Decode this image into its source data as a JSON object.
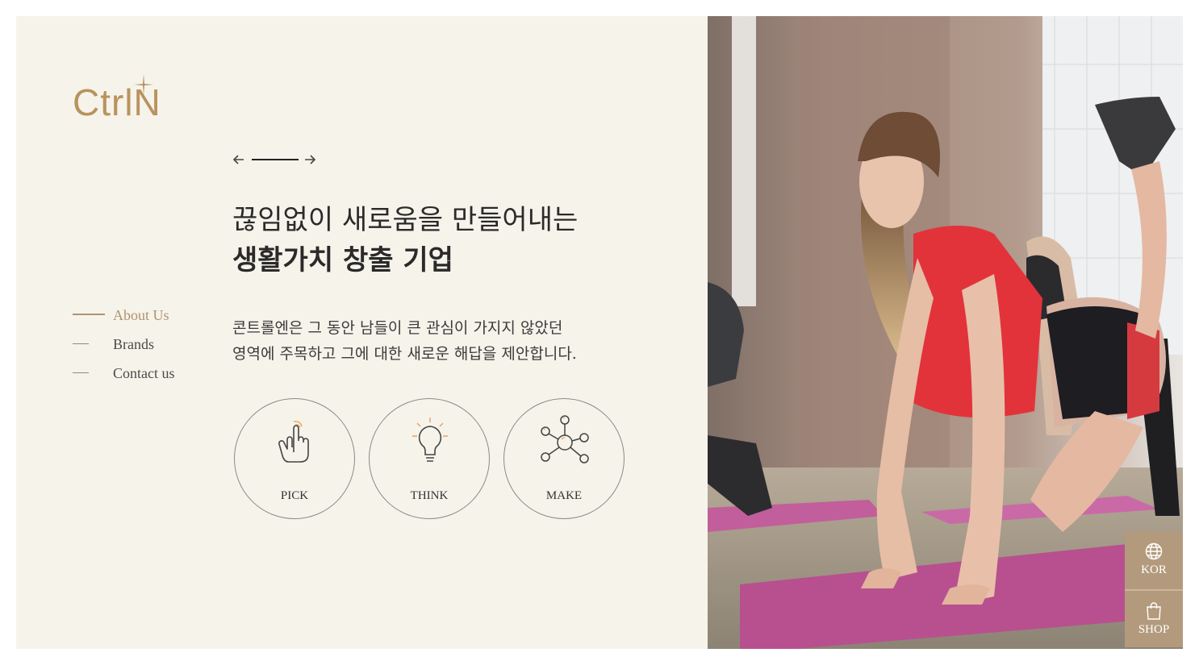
{
  "brand": {
    "logo_text": "CtrlN",
    "accent_color": "#b8935e"
  },
  "slider": {
    "prev_icon": "arrow-left-icon",
    "next_icon": "arrow-right-icon"
  },
  "hero": {
    "headline_line1": "끊임없이 새로움을 만들어내는",
    "headline_line2": "생활가치 창출 기업",
    "description_line1": "콘트롤엔은 그 동안 남들이 큰 관심이 가지지 않았던",
    "description_line2": "영역에 주목하고 그에 대한 새로운 해답을 제안합니다."
  },
  "side_nav": {
    "items": [
      {
        "label": "About Us",
        "active": true
      },
      {
        "label": "Brands",
        "active": false
      },
      {
        "label": "Contact us",
        "active": false
      }
    ]
  },
  "values": {
    "items": [
      {
        "label": "PICK",
        "icon": "pointing-hand-icon"
      },
      {
        "label": "THINK",
        "icon": "lightbulb-icon"
      },
      {
        "label": "MAKE",
        "icon": "network-nodes-icon"
      }
    ]
  },
  "quick_buttons": {
    "language": {
      "label": "KOR",
      "icon": "globe-icon"
    },
    "shop": {
      "label": "SHOP",
      "icon": "shopping-bag-icon"
    }
  },
  "colors": {
    "panel_bg": "#f6f3ea",
    "nav_active": "#b09372",
    "button_bg": "#b39a7d",
    "icon_highlight": "#e8a25b"
  }
}
